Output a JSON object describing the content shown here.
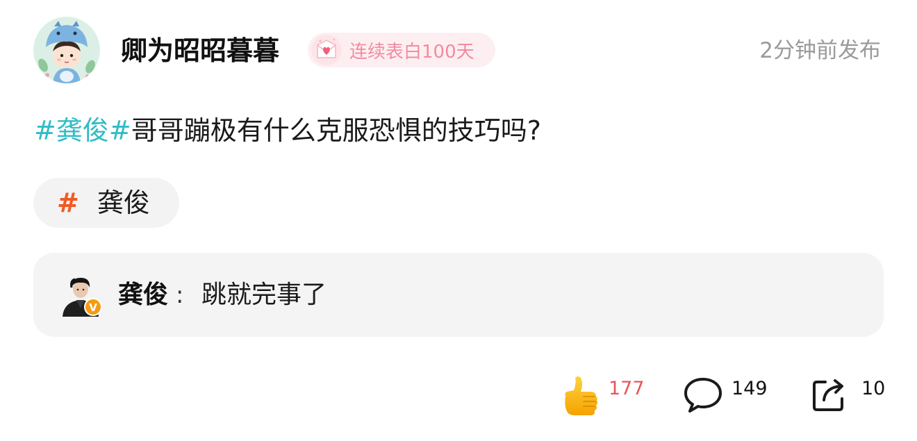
{
  "author": {
    "name": "卿为昭昭暮暮",
    "streak_badge": "连续表白100天",
    "post_time": "2分钟前发布"
  },
  "post": {
    "hashtag": "#龚俊#",
    "text": "哥哥蹦极有什么克服恐惧的技巧吗?"
  },
  "topic": {
    "hash_symbol": "#",
    "label": "龚俊"
  },
  "reply": {
    "author": "龚俊",
    "colon": ":",
    "text": "跳就完事了",
    "verified_badge_letter": "V"
  },
  "actions": {
    "likes": "177",
    "comments": "149",
    "shares": "10"
  },
  "colors": {
    "hashtag": "#2fbcc6",
    "topic_hash": "#f05a24",
    "like_count": "#e8555a",
    "streak_text": "#f28ba0",
    "streak_bg": "#fdeff1",
    "verified_badge": "#f39c12"
  },
  "icons": {
    "like": "thumbs-up-icon",
    "comment": "speech-bubble-icon",
    "share": "share-arrow-icon"
  }
}
